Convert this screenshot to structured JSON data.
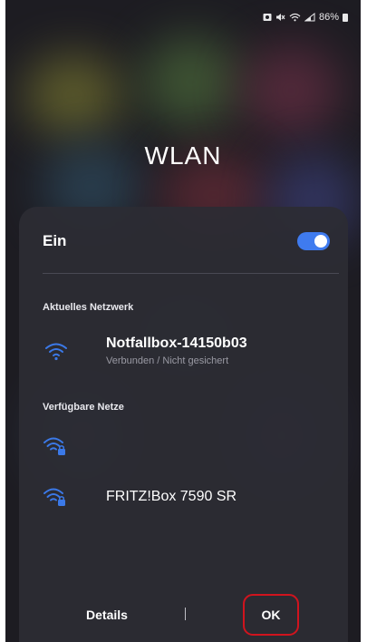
{
  "status_bar": {
    "battery_text": "86%",
    "icons": [
      "gallery-icon",
      "mute-icon",
      "wifi-call-icon",
      "signal-icon",
      "battery-icon"
    ]
  },
  "screen": {
    "title": "WLAN"
  },
  "panel": {
    "toggle": {
      "label": "Ein",
      "state": "on"
    },
    "current_network_heading": "Aktuelles Netzwerk",
    "current_network": {
      "name": "Notfallbox-14150b03",
      "status": "Verbunden / Nicht gesichert",
      "icon": "wifi-icon"
    },
    "available_heading": "Verfügbare Netze",
    "available_networks": [
      {
        "name": "",
        "icon": "wifi-locked-icon"
      },
      {
        "name": "FRITZ!Box 7590 SR",
        "icon": "wifi-locked-icon"
      }
    ]
  },
  "footer": {
    "details_label": "Details",
    "ok_label": "OK"
  },
  "colors": {
    "accent": "#3f7bef",
    "highlight_border": "#d0141e",
    "panel_bg": "#2c2c34",
    "wifi_icon": "#3b79e8"
  }
}
